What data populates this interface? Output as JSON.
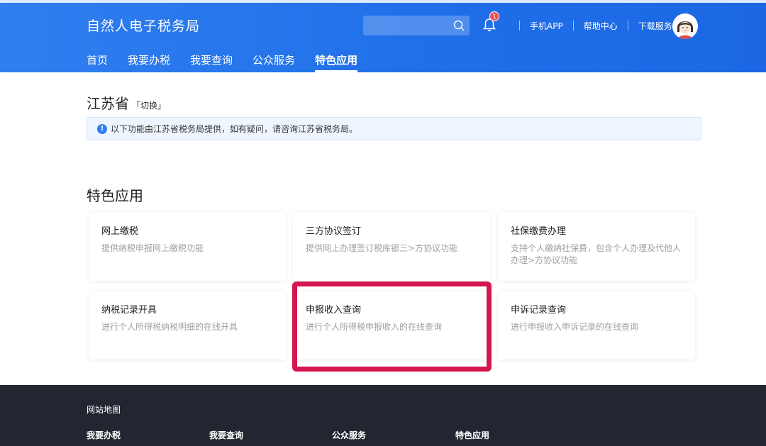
{
  "header": {
    "site_title": "自然人电子税务局",
    "notification_count": "1",
    "links": [
      "手机APP",
      "帮助中心",
      "下载服务"
    ],
    "nav": [
      "首页",
      "我要办税",
      "我要查询",
      "公众服务",
      "特色应用"
    ],
    "active_nav": "特色应用"
  },
  "province": {
    "name": "江苏省",
    "switch_label": "「切换」",
    "notice": "以下功能由江苏省税务局提供，如有疑问，请咨询江苏省税务局。"
  },
  "section": {
    "title": "特色应用",
    "cards": [
      {
        "title": "网上缴税",
        "desc": "提供纳税申报网上缴税功能"
      },
      {
        "title": "三方协议签订",
        "desc": "提供网上办理签订税库银三>方协议功能"
      },
      {
        "title": "社保缴费办理",
        "desc": "支持个人缴纳社保费，包含个人办理及代他人办理>方协议功能"
      },
      {
        "title": "纳税记录开具",
        "desc": "进行个人所得税纳税明细的在线开具"
      },
      {
        "title": "申报收入查询",
        "desc": "进行个人所得税申报收入的在线查询"
      },
      {
        "title": "申诉记录查询",
        "desc": "进行申报收入申诉记录的在线查询"
      }
    ]
  },
  "footer": {
    "title": "网站地图",
    "columns": [
      "我要办税",
      "我要查询",
      "公众服务",
      "特色应用"
    ]
  },
  "colors": {
    "header_blue": "#2f7ff0",
    "highlight_red": "#d5164f",
    "footer_dark": "#222630"
  }
}
